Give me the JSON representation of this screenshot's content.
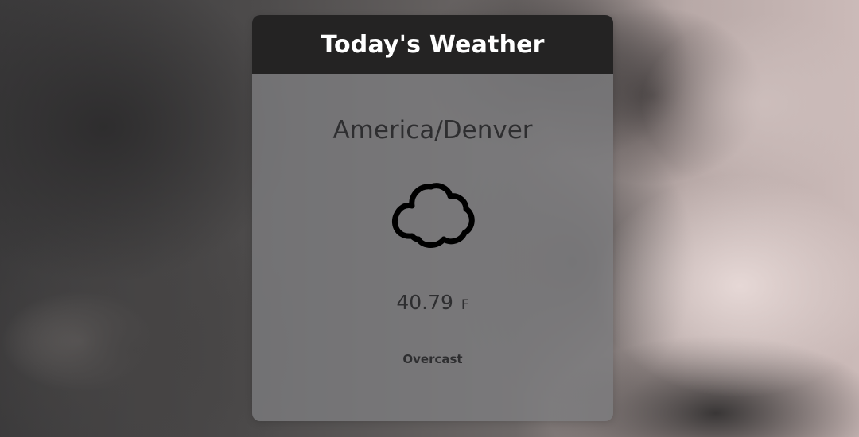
{
  "card": {
    "title": "Today's Weather",
    "location": "America/Denver",
    "icon": "cloud-icon",
    "temperature": "40.79",
    "temperature_unit": "F",
    "condition": "Overcast"
  },
  "colors": {
    "header_bg": "#242323",
    "header_text": "#ffffff",
    "body_text": "#2e2e30",
    "card_bg": "#7d7d80"
  }
}
